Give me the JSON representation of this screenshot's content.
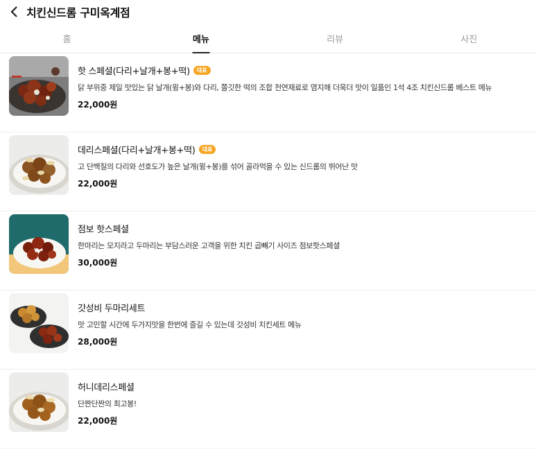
{
  "header": {
    "title": "치킨신드롬 구미옥계점"
  },
  "tabs": [
    {
      "label": "홈",
      "active": false
    },
    {
      "label": "메뉴",
      "active": true
    },
    {
      "label": "리뷰",
      "active": false
    },
    {
      "label": "사진",
      "active": false
    }
  ],
  "colors": {
    "badge": "#f5a623",
    "active_tab": "#222222"
  },
  "menu": [
    {
      "name": "핫 스페셜(다리+날개+봉+떡)",
      "badge": "대표",
      "desc": "닭 부위중 제일 맛있는 닭 날개(윙+봉)와 다리, 쫄깃한 떡의 조합 천연재료로 염지해 더욱더 맛이 일품인 1석 4조 치킨신드롬 베스트 메뉴",
      "price": "22,000원"
    },
    {
      "name": "데리스페셜(다리+날개+봉+떡)",
      "badge": "대표",
      "desc": "고 단백질의 다리와 선호도가 높은 날개(윙+봉)를 섞어 골라먹을 수 있는 신드롬의 뛰어난 맛",
      "price": "22,000원"
    },
    {
      "name": "점보 핫스페셜",
      "badge": "",
      "desc": "한마리는 모지라고 두마리는 부담스러운 고객을 위한 치킨 곱빼기 사이즈 점보핫스페셜",
      "price": "30,000원"
    },
    {
      "name": "갓성비 두마리세트",
      "badge": "",
      "desc": "맛 고민할 시간에 두가지맛을 한번에 즐길 수 있는데 갓성비 치킨세트 메뉴",
      "price": "28,000원"
    },
    {
      "name": "허니데리스페셜",
      "badge": "",
      "desc": "단짠단짠의 최고봉!",
      "price": "22,000원"
    }
  ]
}
